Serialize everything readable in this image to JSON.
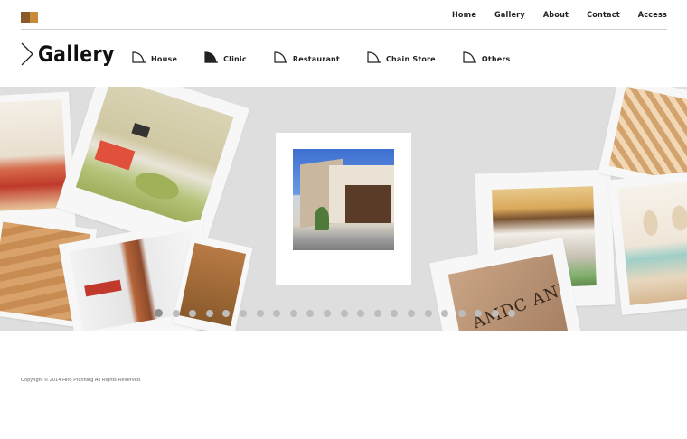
{
  "brand": {
    "logo_colors": [
      "#8a5a2b",
      "#c98a3a"
    ]
  },
  "nav": {
    "items": [
      "Home",
      "Gallery",
      "About",
      "Contact",
      "Access"
    ]
  },
  "page": {
    "title": "Gallery"
  },
  "categories": [
    {
      "label": "House",
      "icon": "house-category-icon",
      "active": false
    },
    {
      "label": "Clinic",
      "icon": "clinic-category-icon",
      "active": true
    },
    {
      "label": "Restaurant",
      "icon": "restaurant-category-icon",
      "active": false
    },
    {
      "label": "Chain Store",
      "icon": "chain-store-category-icon",
      "active": false
    },
    {
      "label": "Others",
      "icon": "others-category-icon",
      "active": false
    }
  ],
  "slider": {
    "total_slides": 22,
    "active_index": 0,
    "sign_text": "AMDC ANNEX"
  },
  "footer": {
    "copyright": "Copyright © 2014 Hiro Planning All Rights Reserved."
  },
  "colors": {
    "stage_bg": "#dedede",
    "photo_frame": "#f7f7f7",
    "accent_wood": "#c98a3a"
  }
}
